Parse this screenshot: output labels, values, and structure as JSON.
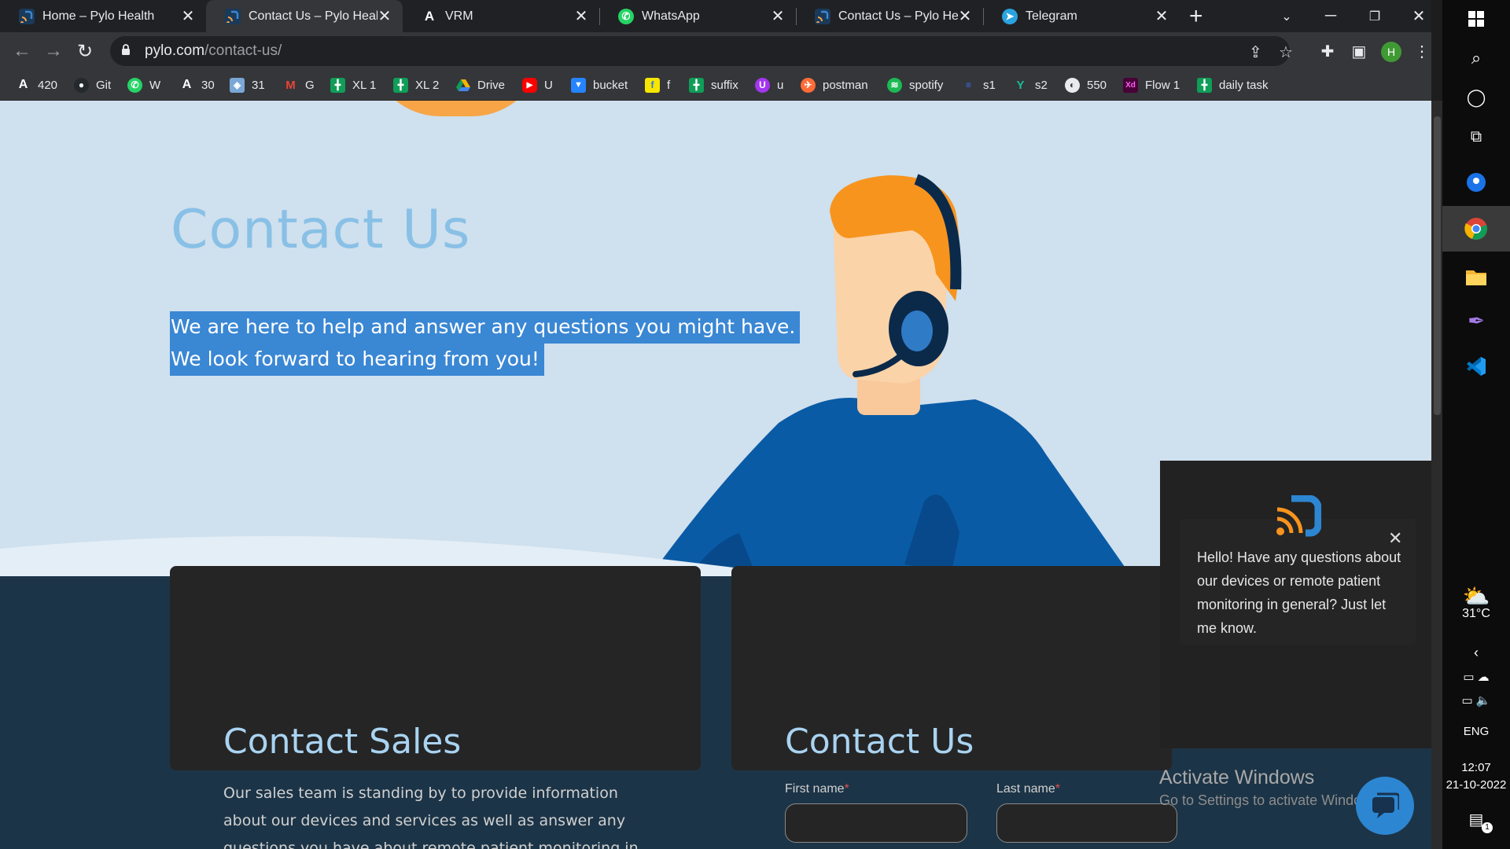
{
  "browser": {
    "tabs": [
      {
        "label": "Home – Pylo Health",
        "icon": "pylo-icon",
        "color": "#3a86d4",
        "active": false
      },
      {
        "label": "Contact Us – Pylo Health",
        "icon": "pylo-icon",
        "color": "#3a86d4",
        "active": true
      },
      {
        "label": "VRM",
        "icon": "vrm-icon",
        "color": "#ffffff",
        "active": false
      },
      {
        "label": "WhatsApp",
        "icon": "whatsapp-icon",
        "color": "#25d366",
        "active": false
      },
      {
        "label": "Contact Us – Pylo Health",
        "icon": "pylo-icon",
        "color": "#3a86d4",
        "active": false
      },
      {
        "label": "Telegram",
        "icon": "telegram-icon",
        "color": "#2aa3df",
        "active": false
      }
    ],
    "tab_close": "✕",
    "new_tab": "+",
    "address": {
      "domain": "pylo.com",
      "path": "/contact-us/"
    },
    "profile_initial": "H",
    "bookmarks": [
      {
        "label": "420",
        "icon": "a-icon",
        "color": "#ffffff"
      },
      {
        "label": "Git",
        "icon": "github-icon",
        "color": "#ffffff"
      },
      {
        "label": "W",
        "icon": "whatsapp-icon",
        "color": "#25d366"
      },
      {
        "label": "30",
        "icon": "a-icon",
        "color": "#ffffff"
      },
      {
        "label": "31",
        "icon": "globe-icon",
        "color": "#7aa7d6"
      },
      {
        "label": "G",
        "icon": "gmail-icon",
        "color": "#ea4335"
      },
      {
        "label": "XL 1",
        "icon": "sheets-icon",
        "color": "#0f9d58"
      },
      {
        "label": "XL 2",
        "icon": "sheets-icon",
        "color": "#0f9d58"
      },
      {
        "label": "Drive",
        "icon": "drive-icon",
        "color": "#f4b400"
      },
      {
        "label": "U",
        "icon": "youtube-icon",
        "color": "#ff0000"
      },
      {
        "label": "bucket",
        "icon": "bitbucket-icon",
        "color": "#2684ff"
      },
      {
        "label": "f",
        "icon": "flipkart-icon",
        "color": "#f7e600"
      },
      {
        "label": "suffix",
        "icon": "sheets-icon",
        "color": "#0f9d58"
      },
      {
        "label": "u",
        "icon": "udemy-icon",
        "color": "#a435f0"
      },
      {
        "label": "postman",
        "icon": "postman-icon",
        "color": "#ff6c37"
      },
      {
        "label": "spotify",
        "icon": "spotify-icon",
        "color": "#1db954"
      },
      {
        "label": "s1",
        "icon": "stack-icon",
        "color": "#3c6df0"
      },
      {
        "label": "s2",
        "icon": "s2-icon",
        "color": "#1abc9c"
      },
      {
        "label": "550",
        "icon": "globe-icon",
        "color": "#e8eaed"
      },
      {
        "label": "Flow 1",
        "icon": "xd-icon",
        "color": "#470137"
      },
      {
        "label": "daily task",
        "icon": "sheets-icon",
        "color": "#0f9d58"
      }
    ]
  },
  "hero": {
    "title": "Contact Us",
    "line1": "We are here to help and answer any questions you might have.",
    "line2": "We look forward to hearing from you!"
  },
  "sales_card": {
    "title": "Contact Sales",
    "text": "Our sales team is standing by to provide information about our devices and services as well as answer any questions you have about remote patient monitoring in general."
  },
  "contact_card": {
    "title": "Contact Us",
    "first_name_label": "First name",
    "last_name_label": "Last name",
    "required_mark": "*"
  },
  "chat": {
    "message": "Hello! Have any questions about our devices or remote patient monitoring in general? Just let me know.",
    "close": "✕"
  },
  "watermark": {
    "title": "Activate Windows",
    "subtitle": "Go to Settings to activate Windows."
  },
  "system": {
    "temperature": "31°C",
    "language": "ENG",
    "time": "12:07",
    "date": "21-10-2022",
    "notification_count": "1"
  }
}
